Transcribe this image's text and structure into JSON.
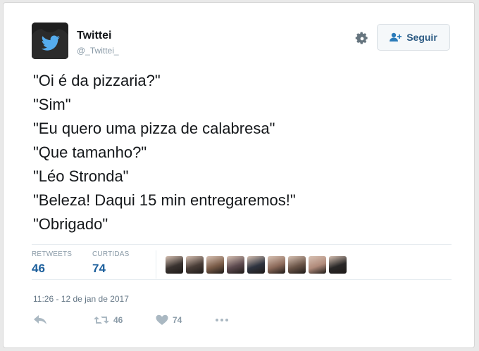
{
  "user": {
    "name": "Twittei",
    "handle": "@_Twittei_"
  },
  "follow_label": "Seguir",
  "tweet_lines": [
    "\"Oi é da pizzaria?\"",
    "\"Sim\"",
    "\"Eu quero uma pizza de calabresa\"",
    "\"Que tamanho?\"",
    "\"Léo Stronda\"",
    "\"Beleza! Daqui 15 min entregaremos!\"",
    "\"Obrigado\""
  ],
  "stats": {
    "retweets_label": "RETWEETS",
    "retweets_value": "46",
    "likes_label": "CURTIDAS",
    "likes_value": "74"
  },
  "liker_colors": [
    "#3a3330",
    "#4a3e38",
    "#7a5c48",
    "#5d4a4f",
    "#2f3440",
    "#8c6a5a",
    "#6b5548",
    "#b08a7a",
    "#2a2828"
  ],
  "timestamp": "11:26 - 12 de jan de 2017",
  "actions": {
    "retweet_count": "46",
    "like_count": "74"
  },
  "colors": {
    "accent": "#1c5f9c",
    "muted": "#8899a6",
    "twitter_blue": "#55acee"
  },
  "icons": [
    "reply-icon",
    "retweet-icon",
    "heart-icon",
    "more-icon",
    "gear-icon",
    "follow-user-icon",
    "twitter-bird-icon"
  ]
}
